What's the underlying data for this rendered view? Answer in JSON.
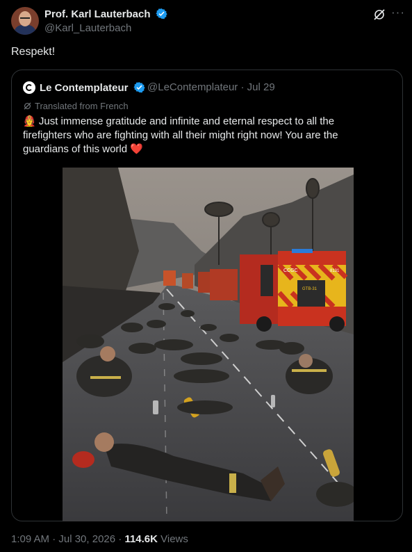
{
  "author": {
    "name": "Prof. Karl Lauterbach",
    "handle": "@Karl_Lauterbach",
    "avatar_icon": "portrait-avatar"
  },
  "tweet": {
    "text": "Respekt!"
  },
  "quote": {
    "author_name": "Le Contemplateur",
    "handle_date": "@LeContemplateur · Jul 29",
    "translated_label": "Translated from French",
    "emoji": "👩‍🚒",
    "text": "Just immense gratitude and infinite and eternal respect to all the firefighters who are fighting with all their might right now! You are the guardians of this world",
    "heart": "❤️",
    "photo_icon": "firefighters-resting-on-road-photo",
    "truck_markings": [
      "CCGC",
      "8131",
      "GTB-31"
    ]
  },
  "footer": {
    "timestamp": "1:09 AM · Jul 30, 2026 · ",
    "views_count": "114.6K",
    "views_label": " Views"
  },
  "colors": {
    "background": "#000000",
    "text": "#e7e9ea",
    "secondary_text": "#71767b",
    "border": "#2f3336",
    "verified": "#1d9bf0",
    "heart": "#f4212e"
  }
}
